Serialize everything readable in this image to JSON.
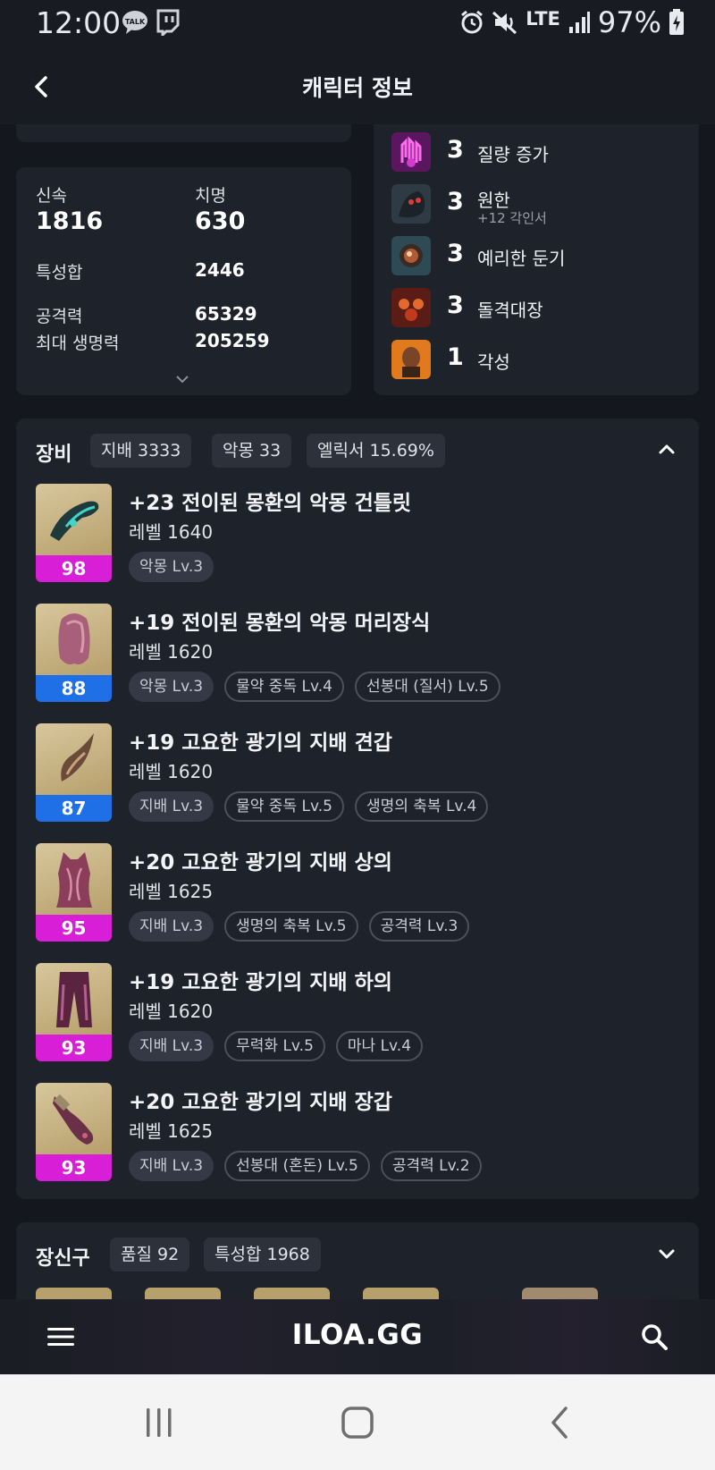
{
  "status_bar": {
    "time": "12:00",
    "talk_badge": "TALK",
    "network": "LTE",
    "battery": "97%"
  },
  "app_bar": {
    "title": "캐릭터 정보"
  },
  "stats": {
    "swiftness_label": "신속",
    "swiftness_value": "1816",
    "crit_label": "치명",
    "crit_value": "630",
    "total_label": "특성합",
    "total_value": "2446",
    "attack_label": "공격력",
    "attack_value": "65329",
    "hp_label": "최대 생명력",
    "hp_value": "205259"
  },
  "engravings": [
    {
      "level": "3",
      "name": "질량 증가",
      "sub": "",
      "icon": "engraving-mass-increase"
    },
    {
      "level": "3",
      "name": "원한",
      "sub": "+12 각인서",
      "icon": "engraving-grudge"
    },
    {
      "level": "3",
      "name": "예리한 둔기",
      "sub": "",
      "icon": "engraving-keen-blunt"
    },
    {
      "level": "3",
      "name": "돌격대장",
      "sub": "",
      "icon": "engraving-raid-captain"
    },
    {
      "level": "1",
      "name": "각성",
      "sub": "",
      "icon": "engraving-awakening"
    }
  ],
  "equipment": {
    "title": "장비",
    "chips": [
      "지배 3333",
      "악몽 33",
      "엘릭서 15.69%"
    ],
    "items": [
      {
        "quality": "98",
        "quality_color": "#d81ed6",
        "name": "+23 전이된 몽환의 악몽 건틀릿",
        "level": "레벨 1640",
        "tags": [
          "악몽 Lv.3"
        ],
        "icon": "gauntlet-icon"
      },
      {
        "quality": "88",
        "quality_color": "#1f6fe6",
        "name": "+19 전이된 몽환의 악몽 머리장식",
        "level": "레벨 1620",
        "tags": [
          "악몽 Lv.3",
          "물약 중독 Lv.4",
          "선봉대 (질서) Lv.5"
        ],
        "icon": "helmet-icon"
      },
      {
        "quality": "87",
        "quality_color": "#1f6fe6",
        "name": "+19 고요한 광기의 지배 견갑",
        "level": "레벨 1620",
        "tags": [
          "지배 Lv.3",
          "물약 중독 Lv.5",
          "생명의 축복 Lv.4"
        ],
        "icon": "shoulder-icon"
      },
      {
        "quality": "95",
        "quality_color": "#d81ed6",
        "name": "+20 고요한 광기의 지배 상의",
        "level": "레벨 1625",
        "tags": [
          "지배 Lv.3",
          "생명의 축복 Lv.5",
          "공격력 Lv.3"
        ],
        "icon": "chest-icon"
      },
      {
        "quality": "93",
        "quality_color": "#d81ed6",
        "name": "+19 고요한 광기의 지배 하의",
        "level": "레벨 1620",
        "tags": [
          "지배 Lv.3",
          "무력화 Lv.5",
          "마나 Lv.4"
        ],
        "icon": "pants-icon"
      },
      {
        "quality": "93",
        "quality_color": "#d81ed6",
        "name": "+20 고요한 광기의 지배 장갑",
        "level": "레벨 1625",
        "tags": [
          "지배 Lv.3",
          "선봉대 (혼돈) Lv.5",
          "공격력 Lv.2"
        ],
        "icon": "gloves-icon"
      }
    ]
  },
  "accessories": {
    "title": "장신구",
    "chips": [
      "품질 92",
      "특성합 1968"
    ]
  },
  "bottom_bar": {
    "brand": "ILOA.GG"
  },
  "colors": {
    "background": "#14171d",
    "card": "#1e222a",
    "quality_magenta": "#d81ed6",
    "quality_blue": "#1f6fe6"
  }
}
